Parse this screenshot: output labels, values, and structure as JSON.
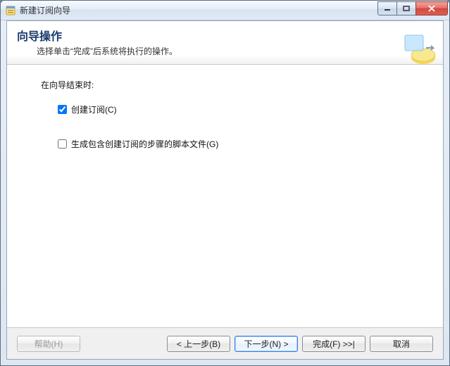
{
  "window": {
    "title": "新建订阅向导"
  },
  "header": {
    "title": "向导操作",
    "subtitle": "选择单击“完成”后系统将执行的操作。"
  },
  "content": {
    "lead": "在向导结束时:",
    "options": [
      {
        "label": "创建订阅(C)",
        "checked": true
      },
      {
        "label": "生成包含创建订阅的步骤的脚本文件(G)",
        "checked": false
      }
    ]
  },
  "footer": {
    "help": "帮助(H)",
    "back": "< 上一步(B)",
    "next": "下一步(N) >",
    "finish": "完成(F) >>|",
    "cancel": "取消"
  }
}
